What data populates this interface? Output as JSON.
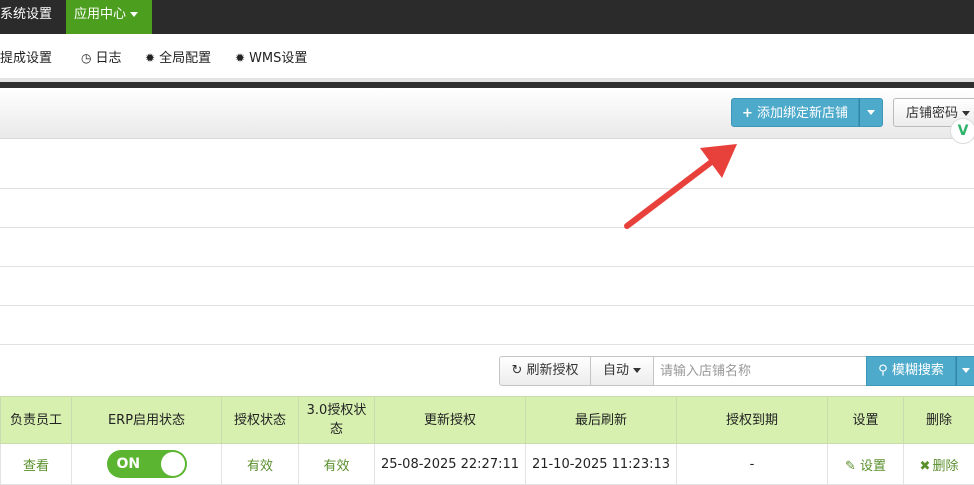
{
  "topnav": {
    "items": [
      {
        "label": "系统设置"
      },
      {
        "label": "应用中心"
      }
    ]
  },
  "subnav": {
    "items": [
      {
        "label": "错提成设置",
        "icon": ""
      },
      {
        "label": "日志",
        "icon": "clock-icon"
      },
      {
        "label": "全局配置",
        "icon": "gear-icon"
      },
      {
        "label": "WMS设置",
        "icon": "gear-icon"
      }
    ]
  },
  "header": {
    "add_button": "添加绑定新店铺",
    "shop_password": "店铺密码"
  },
  "toolbar": {
    "refresh_label": "刷新授权",
    "auto_label": "自动",
    "search_placeholder": "请输入店铺名称",
    "search_label": "模糊搜索"
  },
  "table": {
    "headers": [
      "负责员工",
      "ERP启用状态",
      "授权状态",
      "3.0授权状态",
      "更新授权",
      "最后刷新",
      "授权到期",
      "设置",
      "删除"
    ],
    "rows": [
      {
        "staff": "查看",
        "erp_toggle": "ON",
        "auth_status": "有效",
        "auth30_status": "有效",
        "updated": "25-08-2025 22:27:11",
        "last_refresh": "21-10-2025 11:23:13",
        "expiry": "-",
        "settings": "设置",
        "delete": "删除"
      }
    ]
  },
  "colors": {
    "accent_blue": "#4eaacb",
    "nav_green": "#4c9e1e",
    "header_green": "#d7f0b0",
    "toggle_green": "#5cb531",
    "arrow_red": "#e8413b"
  }
}
